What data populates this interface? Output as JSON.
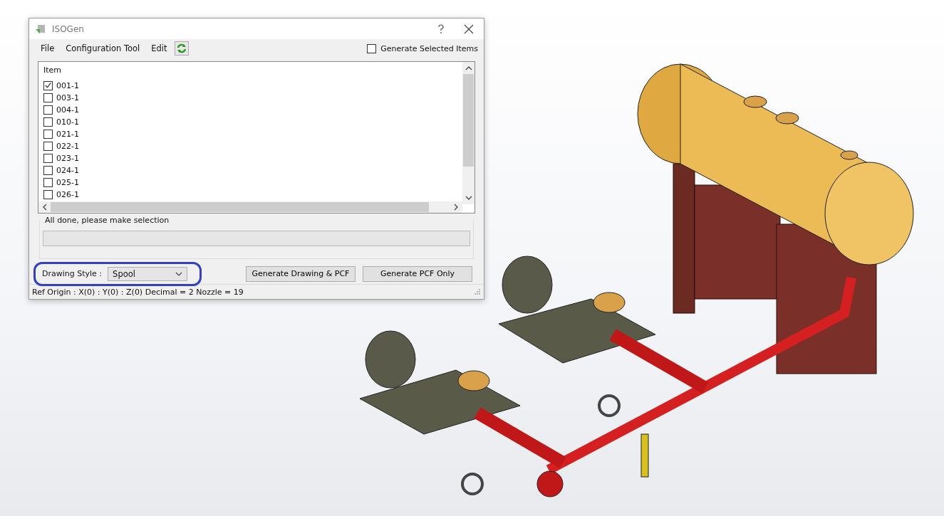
{
  "window": {
    "title": "ISOGen"
  },
  "menu": [
    "File",
    "Configuration Tool",
    "Edit"
  ],
  "generate_selected_items": {
    "label": "Generate Selected Items",
    "checked": false
  },
  "list": {
    "header": "Item",
    "items": [
      {
        "label": "001-1",
        "checked": true
      },
      {
        "label": "003-1",
        "checked": false
      },
      {
        "label": "004-1",
        "checked": false
      },
      {
        "label": "010-1",
        "checked": false
      },
      {
        "label": "021-1",
        "checked": false
      },
      {
        "label": "022-1",
        "checked": false
      },
      {
        "label": "023-1",
        "checked": false
      },
      {
        "label": "024-1",
        "checked": false
      },
      {
        "label": "025-1",
        "checked": false
      },
      {
        "label": "026-1",
        "checked": false
      }
    ]
  },
  "progress": {
    "label": "All done, please make selection",
    "level": 0
  },
  "drawing_style": {
    "label": "Drawing Style :",
    "value": "Spool"
  },
  "buttons": [
    "Generate Drawing & PCF",
    "Generate PCF Only"
  ],
  "status_bar": "Ref Origin : X(0) : Y(0) : Z(0)  Decimal = 2  Nozzle = 19"
}
